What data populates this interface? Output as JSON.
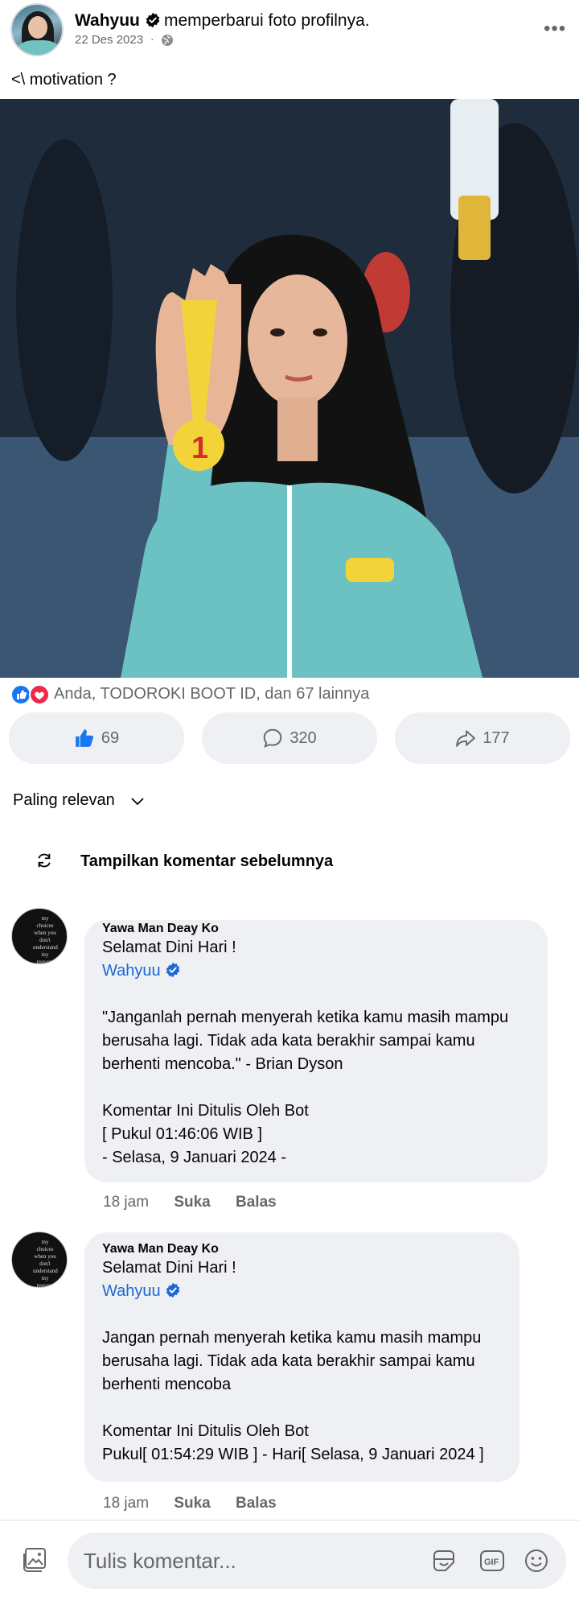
{
  "post": {
    "author": "Wahyuu",
    "action": "memperbarui foto profilnya.",
    "date": "22 Des 2023",
    "caption": "<\\ motivation ?",
    "reactions_text": "Anda, TODOROKI BOOT ID, dan 67 lainnya",
    "like_count": "69",
    "comment_count": "320",
    "share_count": "177"
  },
  "sort": {
    "label": "Paling relevan"
  },
  "load_previous": {
    "label": "Tampilkan komentar sebelumnya"
  },
  "comments": [
    {
      "author": "Yawa Man Deay Ko",
      "greeting": "Selamat Dini Hari !",
      "mention": "Wahyuu",
      "lines": [
        "\"Janganlah pernah menyerah ketika kamu masih mampu",
        "berusaha lagi. Tidak ada kata berakhir sampai kamu",
        "berhenti mencoba.\" - Brian Dyson",
        "Komentar Ini Ditulis Oleh Bot",
        "[ Pukul 01:46:06 WIB ]",
        "- Selasa, 9 Januari 2024 -"
      ],
      "time": "18 jam",
      "like_label": "Suka",
      "reply_label": "Balas"
    },
    {
      "author": "Yawa Man Deay Ko",
      "greeting": "Selamat Dini Hari !",
      "mention": "Wahyuu",
      "lines": [
        "Jangan pernah menyerah ketika kamu masih mampu",
        "berusaha lagi. Tidak ada kata berakhir sampai kamu",
        "berhenti mencoba",
        "Komentar Ini Ditulis Oleh Bot",
        "Pukul[ 01:54:29 WIB ] - Hari[ Selasa, 9 Januari 2024 ]"
      ],
      "time": "18 jam",
      "like_label": "Suka",
      "reply_label": "Balas"
    }
  ],
  "avatar_text": "my choices when you don't understand my reasons",
  "composer": {
    "placeholder": "Tulis komentar..."
  },
  "colors": {
    "accent": "#1877f2",
    "mention": "#1a69d3",
    "love": "#f02849",
    "secondary_text": "#65676b",
    "pill_bg": "#eff0f3"
  },
  "icons": [
    "verified-badge-icon",
    "globe-icon",
    "more-icon",
    "like-icon",
    "love-icon",
    "thumbs-up-icon",
    "comment-icon",
    "share-icon",
    "chevron-down-icon",
    "refresh-icon",
    "photo-icon",
    "sticker-icon",
    "gif-icon",
    "emoji-icon"
  ]
}
